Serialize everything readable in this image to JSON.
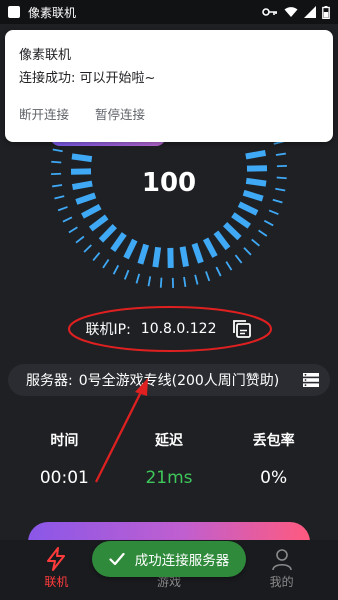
{
  "statusbar": {
    "app_name": "像素联机"
  },
  "notification": {
    "title": "像素联机",
    "text": "连接成功: 可以开始啦~",
    "actions": [
      "断开连接",
      "暂停连接"
    ]
  },
  "gauge": {
    "value": "100",
    "accent": "#3fa9f5"
  },
  "ip": {
    "label": "联机IP:",
    "value": "10.8.0.122"
  },
  "server": {
    "label": "服务器:",
    "name": "0号全游戏专线(200人周门赞助)"
  },
  "stats": [
    {
      "label": "时间",
      "value": "00:01"
    },
    {
      "label": "延迟",
      "value": "21ms"
    },
    {
      "label": "丢包率",
      "value": "0%"
    }
  ],
  "tabs": [
    {
      "label": "联机",
      "icon": "lightning-icon"
    },
    {
      "label": "游戏",
      "icon": "gamepad-icon"
    },
    {
      "label": "我的",
      "icon": "user-icon"
    }
  ],
  "toast": {
    "text": "成功连接服务器"
  },
  "colors": {
    "background": "#1f2024",
    "active_tab": "#ff3b3b",
    "latency_green": "#3ec75b",
    "toast_green": "#2f8a3b",
    "annotation_red": "#e02020"
  }
}
